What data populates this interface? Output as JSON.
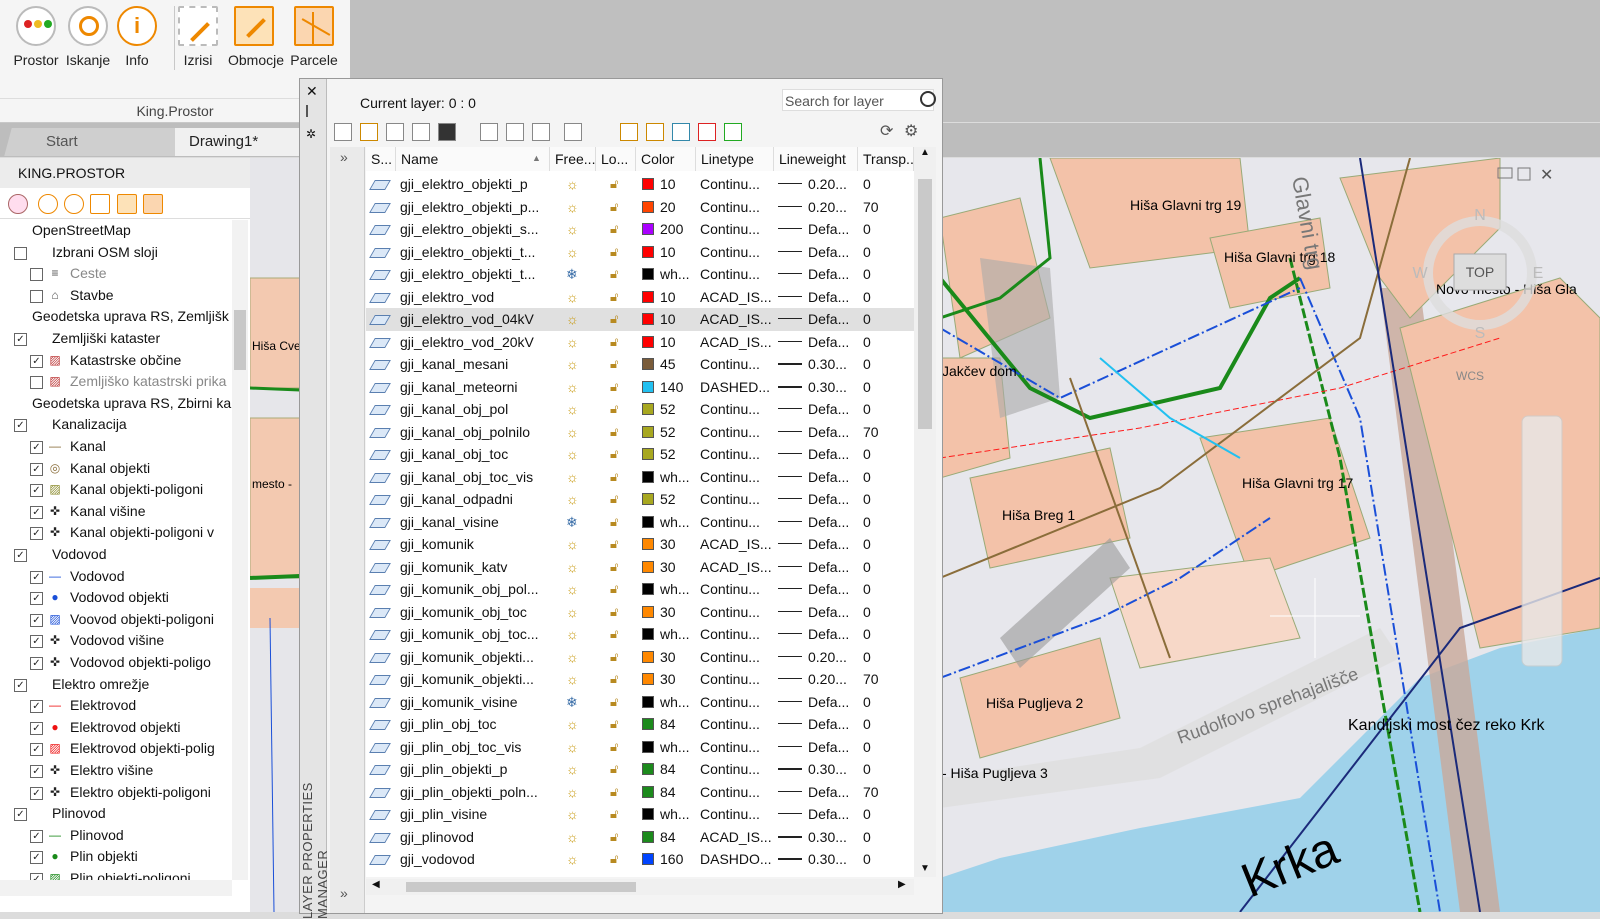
{
  "ribbon": {
    "buttons": [
      {
        "id": "prostor",
        "label": "Prostor"
      },
      {
        "id": "iskanje",
        "label": "Iskanje"
      },
      {
        "id": "info",
        "label": "Info"
      },
      {
        "id": "izrisi",
        "label": "Izrisi"
      },
      {
        "id": "obmocje",
        "label": "Obmocje"
      },
      {
        "id": "parcele",
        "label": "Parcele"
      }
    ],
    "group_label": "King.Prostor"
  },
  "tabs": {
    "start": "Start",
    "drawing": "Drawing1*"
  },
  "left_panel": {
    "title": "KING.PROSTOR",
    "tree": [
      {
        "label": "OpenStreetMap",
        "level": 0,
        "check": "",
        "icon": ""
      },
      {
        "label": "Izbrani OSM sloji",
        "level": 1,
        "check": "off",
        "icon": ""
      },
      {
        "label": "Ceste",
        "level": 2,
        "check": "off",
        "icon": "cest",
        "dim": true
      },
      {
        "label": "Stavbe",
        "level": 2,
        "check": "off",
        "icon": "house"
      },
      {
        "label": "Geodetska uprava RS, Zemljišk",
        "level": 0,
        "check": "",
        "icon": ""
      },
      {
        "label": "Zemljiški kataster",
        "level": 1,
        "check": "on",
        "icon": ""
      },
      {
        "label": "Katastrske občine",
        "level": 2,
        "check": "on",
        "icon": "hatch"
      },
      {
        "label": "Zemljiško katastrski prika",
        "level": 2,
        "check": "off",
        "icon": "hatch",
        "dim": true
      },
      {
        "label": "Geodetska uprava RS, Zbirni ka",
        "level": 0,
        "check": "",
        "icon": ""
      },
      {
        "label": "Kanalizacija",
        "level": 1,
        "check": "on",
        "icon": ""
      },
      {
        "label": "Kanal",
        "level": 2,
        "check": "on",
        "icon": "line-olive"
      },
      {
        "label": "Kanal objekti",
        "level": 2,
        "check": "on",
        "icon": "circle-olive"
      },
      {
        "label": "Kanal objekti-poligoni",
        "level": 2,
        "check": "on",
        "icon": "hatch-olive"
      },
      {
        "label": "Kanal višine",
        "level": 2,
        "check": "on",
        "icon": "target"
      },
      {
        "label": "Kanal objekti-poligoni v",
        "level": 2,
        "check": "on",
        "icon": "target"
      },
      {
        "label": "Vodovod",
        "level": 1,
        "check": "on",
        "icon": ""
      },
      {
        "label": "Vodovod",
        "level": 2,
        "check": "on",
        "icon": "line-blue"
      },
      {
        "label": "Vodovod objekti",
        "level": 2,
        "check": "on",
        "icon": "dot-blue"
      },
      {
        "label": "Voovod objekti-poligoni",
        "level": 2,
        "check": "on",
        "icon": "hatch-blue"
      },
      {
        "label": "Vodovod višine",
        "level": 2,
        "check": "on",
        "icon": "target"
      },
      {
        "label": "Vodovod objekti-poligo",
        "level": 2,
        "check": "on",
        "icon": "target"
      },
      {
        "label": "Elektro omrežje",
        "level": 1,
        "check": "on",
        "icon": ""
      },
      {
        "label": "Elektrovod",
        "level": 2,
        "check": "on",
        "icon": "line-red"
      },
      {
        "label": "Elektrovod objekti",
        "level": 2,
        "check": "on",
        "icon": "dot-red"
      },
      {
        "label": "Elektrovod objekti-polig",
        "level": 2,
        "check": "on",
        "icon": "hatch-red"
      },
      {
        "label": "Elektro višine",
        "level": 2,
        "check": "on",
        "icon": "target"
      },
      {
        "label": "Elektro objekti-poligoni",
        "level": 2,
        "check": "on",
        "icon": "target"
      },
      {
        "label": "Plinovod",
        "level": 1,
        "check": "on",
        "icon": ""
      },
      {
        "label": "Plinovod",
        "level": 2,
        "check": "on",
        "icon": "line-green"
      },
      {
        "label": "Plin objekti",
        "level": 2,
        "check": "on",
        "icon": "dot-green"
      },
      {
        "label": "Plin objekti-poligoni",
        "level": 2,
        "check": "on",
        "icon": "hatch-green"
      }
    ]
  },
  "layer_manager": {
    "side_title": "LAYER PROPERTIES MANAGER",
    "current_layer": "Current layer: 0 : 0",
    "search_placeholder": "Search for layer",
    "columns": [
      "S...",
      "Name",
      "Free...",
      "Lo...",
      "Color",
      "Linetype",
      "Lineweight",
      "Transp..."
    ],
    "rows": [
      {
        "name": "gji_elektro_objekti_p",
        "freeze": "sun",
        "color": "#ff0000",
        "color_label": "10",
        "linetype": "Continu...",
        "lineweight": "0.20...",
        "lw_line": "thin",
        "transp": "0"
      },
      {
        "name": "gji_elektro_objekti_p...",
        "freeze": "sun",
        "color": "#ff4400",
        "color_label": "20",
        "linetype": "Continu...",
        "lineweight": "0.20...",
        "lw_line": "thin",
        "transp": "70"
      },
      {
        "name": "gji_elektro_objekti_s...",
        "freeze": "sun",
        "color": "#aa00ff",
        "color_label": "200",
        "linetype": "Continu...",
        "lineweight": "Defa...",
        "lw_line": "thin",
        "transp": "0"
      },
      {
        "name": "gji_elektro_objekti_t...",
        "freeze": "sun",
        "color": "#ff0000",
        "color_label": "10",
        "linetype": "Continu...",
        "lineweight": "Defa...",
        "lw_line": "thin",
        "transp": "0"
      },
      {
        "name": "gji_elektro_objekti_t...",
        "freeze": "snow",
        "color": "#000000",
        "color_label": "wh...",
        "linetype": "Continu...",
        "lineweight": "Defa...",
        "lw_line": "thin",
        "transp": "0"
      },
      {
        "name": "gji_elektro_vod",
        "freeze": "sun",
        "color": "#ff0000",
        "color_label": "10",
        "linetype": "ACAD_IS...",
        "lineweight": "Defa...",
        "lw_line": "thin",
        "transp": "0"
      },
      {
        "name": "gji_elektro_vod_04kV",
        "freeze": "sun",
        "color": "#ff0000",
        "color_label": "10",
        "linetype": "ACAD_IS...",
        "lineweight": "Defa...",
        "lw_line": "thin",
        "transp": "0",
        "selected": true
      },
      {
        "name": "gji_elektro_vod_20kV",
        "freeze": "sun",
        "color": "#ff0000",
        "color_label": "10",
        "linetype": "ACAD_IS...",
        "lineweight": "Defa...",
        "lw_line": "thin",
        "transp": "0"
      },
      {
        "name": "gji_kanal_mesani",
        "freeze": "sun",
        "color": "#7a5c3a",
        "color_label": "45",
        "linetype": "Continu...",
        "lineweight": "0.30...",
        "lw_line": "bold",
        "transp": "0"
      },
      {
        "name": "gji_kanal_meteorni",
        "freeze": "sun",
        "color": "#22c0f0",
        "color_label": "140",
        "linetype": "DASHED...",
        "lineweight": "0.30...",
        "lw_line": "bold",
        "transp": "0"
      },
      {
        "name": "gji_kanal_obj_pol",
        "freeze": "sun",
        "color": "#a8a820",
        "color_label": "52",
        "linetype": "Continu...",
        "lineweight": "Defa...",
        "lw_line": "thin",
        "transp": "0"
      },
      {
        "name": "gji_kanal_obj_polnilo",
        "freeze": "sun",
        "color": "#a8a820",
        "color_label": "52",
        "linetype": "Continu...",
        "lineweight": "Defa...",
        "lw_line": "thin",
        "transp": "70"
      },
      {
        "name": "gji_kanal_obj_toc",
        "freeze": "sun",
        "color": "#a8a820",
        "color_label": "52",
        "linetype": "Continu...",
        "lineweight": "Defa...",
        "lw_line": "thin",
        "transp": "0"
      },
      {
        "name": "gji_kanal_obj_toc_vis",
        "freeze": "sun",
        "color": "#000000",
        "color_label": "wh...",
        "linetype": "Continu...",
        "lineweight": "Defa...",
        "lw_line": "thin",
        "transp": "0"
      },
      {
        "name": "gji_kanal_odpadni",
        "freeze": "sun",
        "color": "#a8a820",
        "color_label": "52",
        "linetype": "Continu...",
        "lineweight": "Defa...",
        "lw_line": "thin",
        "transp": "0"
      },
      {
        "name": "gji_kanal_visine",
        "freeze": "snow",
        "color": "#000000",
        "color_label": "wh...",
        "linetype": "Continu...",
        "lineweight": "Defa...",
        "lw_line": "thin",
        "transp": "0"
      },
      {
        "name": "gji_komunik",
        "freeze": "sun",
        "color": "#ff8800",
        "color_label": "30",
        "linetype": "ACAD_IS...",
        "lineweight": "Defa...",
        "lw_line": "thin",
        "transp": "0"
      },
      {
        "name": "gji_komunik_katv",
        "freeze": "sun",
        "color": "#ff8800",
        "color_label": "30",
        "linetype": "ACAD_IS...",
        "lineweight": "Defa...",
        "lw_line": "thin",
        "transp": "0"
      },
      {
        "name": "gji_komunik_obj_pol...",
        "freeze": "sun",
        "color": "#000000",
        "color_label": "wh...",
        "linetype": "Continu...",
        "lineweight": "Defa...",
        "lw_line": "thin",
        "transp": "0"
      },
      {
        "name": "gji_komunik_obj_toc",
        "freeze": "sun",
        "color": "#ff8800",
        "color_label": "30",
        "linetype": "Continu...",
        "lineweight": "Defa...",
        "lw_line": "thin",
        "transp": "0"
      },
      {
        "name": "gji_komunik_obj_toc...",
        "freeze": "sun",
        "color": "#000000",
        "color_label": "wh...",
        "linetype": "Continu...",
        "lineweight": "Defa...",
        "lw_line": "thin",
        "transp": "0"
      },
      {
        "name": "gji_komunik_objekti...",
        "freeze": "sun",
        "color": "#ff8800",
        "color_label": "30",
        "linetype": "Continu...",
        "lineweight": "0.20...",
        "lw_line": "thin",
        "transp": "0"
      },
      {
        "name": "gji_komunik_objekti...",
        "freeze": "sun",
        "color": "#ff8800",
        "color_label": "30",
        "linetype": "Continu...",
        "lineweight": "0.20...",
        "lw_line": "thin",
        "transp": "70"
      },
      {
        "name": "gji_komunik_visine",
        "freeze": "snow",
        "color": "#000000",
        "color_label": "wh...",
        "linetype": "Continu...",
        "lineweight": "Defa...",
        "lw_line": "thin",
        "transp": "0"
      },
      {
        "name": "gji_plin_obj_toc",
        "freeze": "sun",
        "color": "#1c8a1c",
        "color_label": "84",
        "linetype": "Continu...",
        "lineweight": "Defa...",
        "lw_line": "thin",
        "transp": "0"
      },
      {
        "name": "gji_plin_obj_toc_vis",
        "freeze": "sun",
        "color": "#000000",
        "color_label": "wh...",
        "linetype": "Continu...",
        "lineweight": "Defa...",
        "lw_line": "thin",
        "transp": "0"
      },
      {
        "name": "gji_plin_objekti_p",
        "freeze": "sun",
        "color": "#1c8a1c",
        "color_label": "84",
        "linetype": "Continu...",
        "lineweight": "0.30...",
        "lw_line": "bold",
        "transp": "0"
      },
      {
        "name": "gji_plin_objekti_poln...",
        "freeze": "sun",
        "color": "#1c8a1c",
        "color_label": "84",
        "linetype": "Continu...",
        "lineweight": "Defa...",
        "lw_line": "thin",
        "transp": "70"
      },
      {
        "name": "gji_plin_visine",
        "freeze": "sun",
        "color": "#000000",
        "color_label": "wh...",
        "linetype": "Continu...",
        "lineweight": "Defa...",
        "lw_line": "thin",
        "transp": "0"
      },
      {
        "name": "gji_plinovod",
        "freeze": "sun",
        "color": "#1c8a1c",
        "color_label": "84",
        "linetype": "ACAD_IS...",
        "lineweight": "0.30...",
        "lw_line": "bold",
        "transp": "0"
      },
      {
        "name": "gji_vodovod",
        "freeze": "sun",
        "color": "#0044ff",
        "color_label": "160",
        "linetype": "DASHDO...",
        "lineweight": "0.30...",
        "lw_line": "bold",
        "transp": "0"
      }
    ]
  },
  "map": {
    "labels": [
      {
        "id": "glavni19",
        "text": "Hiša Glavni trg 19"
      },
      {
        "id": "glavni18",
        "text": "Hiša Glavni trg 18"
      },
      {
        "id": "novomesto",
        "text": "Novo mesto - Hiša Gla"
      },
      {
        "id": "jakcev",
        "text": "Jakčev dom"
      },
      {
        "id": "glavni17",
        "text": "Hiša Glavni trg 17"
      },
      {
        "id": "breg1",
        "text": "Hiša Breg 1"
      },
      {
        "id": "puglj2",
        "text": "Hiša Pugljeva 2"
      },
      {
        "id": "puglj3",
        "text": "- Hiša Pugljeva 3"
      },
      {
        "id": "rudolf",
        "text": "Rudolfovo sprehajališče"
      },
      {
        "id": "kandij",
        "text": "Kandijski most čez reko Krk"
      },
      {
        "id": "krka",
        "text": "Krka"
      },
      {
        "id": "glavni",
        "text": "Glavni trg"
      }
    ],
    "left_labels": [
      {
        "id": "cvelt",
        "text": "Hiša Cvelt"
      },
      {
        "id": "mesto",
        "text": "mesto -"
      }
    ],
    "viewcube": {
      "top": "TOP",
      "n": "N",
      "s": "S",
      "e": "E",
      "w": "W",
      "wcs": "WCS"
    }
  }
}
